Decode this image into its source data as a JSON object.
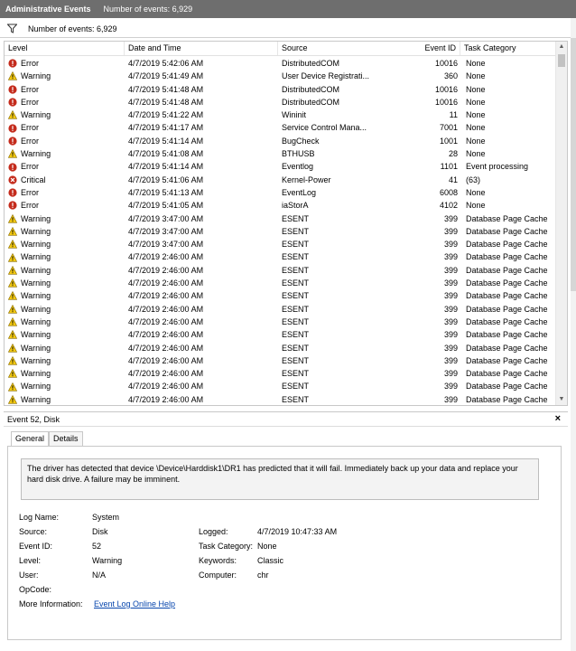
{
  "window": {
    "title": "Administrative Events",
    "count_label": "Number of events: 6,929"
  },
  "filter": {
    "label": "Number of events: 6,929"
  },
  "columns": {
    "level": "Level",
    "date": "Date and Time",
    "source": "Source",
    "event_id": "Event ID",
    "task": "Task Category"
  },
  "events": [
    {
      "level": "Error",
      "icon": "error",
      "date": "4/7/2019 5:42:06 AM",
      "source": "DistributedCOM",
      "id": "10016",
      "task": "None"
    },
    {
      "level": "Warning",
      "icon": "warning",
      "date": "4/7/2019 5:41:49 AM",
      "source": "User Device Registrati...",
      "id": "360",
      "task": "None"
    },
    {
      "level": "Error",
      "icon": "error",
      "date": "4/7/2019 5:41:48 AM",
      "source": "DistributedCOM",
      "id": "10016",
      "task": "None"
    },
    {
      "level": "Error",
      "icon": "error",
      "date": "4/7/2019 5:41:48 AM",
      "source": "DistributedCOM",
      "id": "10016",
      "task": "None"
    },
    {
      "level": "Warning",
      "icon": "warning",
      "date": "4/7/2019 5:41:22 AM",
      "source": "Wininit",
      "id": "11",
      "task": "None"
    },
    {
      "level": "Error",
      "icon": "error",
      "date": "4/7/2019 5:41:17 AM",
      "source": "Service Control Mana...",
      "id": "7001",
      "task": "None"
    },
    {
      "level": "Error",
      "icon": "error",
      "date": "4/7/2019 5:41:14 AM",
      "source": "BugCheck",
      "id": "1001",
      "task": "None"
    },
    {
      "level": "Warning",
      "icon": "warning",
      "date": "4/7/2019 5:41:08 AM",
      "source": "BTHUSB",
      "id": "28",
      "task": "None"
    },
    {
      "level": "Error",
      "icon": "error",
      "date": "4/7/2019 5:41:14 AM",
      "source": "Eventlog",
      "id": "1101",
      "task": "Event processing"
    },
    {
      "level": "Critical",
      "icon": "critical",
      "date": "4/7/2019 5:41:06 AM",
      "source": "Kernel-Power",
      "id": "41",
      "task": "(63)"
    },
    {
      "level": "Error",
      "icon": "error",
      "date": "4/7/2019 5:41:13 AM",
      "source": "EventLog",
      "id": "6008",
      "task": "None"
    },
    {
      "level": "Error",
      "icon": "error",
      "date": "4/7/2019 5:41:05 AM",
      "source": "iaStorA",
      "id": "4102",
      "task": "None"
    },
    {
      "level": "Warning",
      "icon": "warning",
      "date": "4/7/2019 3:47:00 AM",
      "source": "ESENT",
      "id": "399",
      "task": "Database Page Cache"
    },
    {
      "level": "Warning",
      "icon": "warning",
      "date": "4/7/2019 3:47:00 AM",
      "source": "ESENT",
      "id": "399",
      "task": "Database Page Cache"
    },
    {
      "level": "Warning",
      "icon": "warning",
      "date": "4/7/2019 3:47:00 AM",
      "source": "ESENT",
      "id": "399",
      "task": "Database Page Cache"
    },
    {
      "level": "Warning",
      "icon": "warning",
      "date": "4/7/2019 2:46:00 AM",
      "source": "ESENT",
      "id": "399",
      "task": "Database Page Cache"
    },
    {
      "level": "Warning",
      "icon": "warning",
      "date": "4/7/2019 2:46:00 AM",
      "source": "ESENT",
      "id": "399",
      "task": "Database Page Cache"
    },
    {
      "level": "Warning",
      "icon": "warning",
      "date": "4/7/2019 2:46:00 AM",
      "source": "ESENT",
      "id": "399",
      "task": "Database Page Cache"
    },
    {
      "level": "Warning",
      "icon": "warning",
      "date": "4/7/2019 2:46:00 AM",
      "source": "ESENT",
      "id": "399",
      "task": "Database Page Cache"
    },
    {
      "level": "Warning",
      "icon": "warning",
      "date": "4/7/2019 2:46:00 AM",
      "source": "ESENT",
      "id": "399",
      "task": "Database Page Cache"
    },
    {
      "level": "Warning",
      "icon": "warning",
      "date": "4/7/2019 2:46:00 AM",
      "source": "ESENT",
      "id": "399",
      "task": "Database Page Cache"
    },
    {
      "level": "Warning",
      "icon": "warning",
      "date": "4/7/2019 2:46:00 AM",
      "source": "ESENT",
      "id": "399",
      "task": "Database Page Cache"
    },
    {
      "level": "Warning",
      "icon": "warning",
      "date": "4/7/2019 2:46:00 AM",
      "source": "ESENT",
      "id": "399",
      "task": "Database Page Cache"
    },
    {
      "level": "Warning",
      "icon": "warning",
      "date": "4/7/2019 2:46:00 AM",
      "source": "ESENT",
      "id": "399",
      "task": "Database Page Cache"
    },
    {
      "level": "Warning",
      "icon": "warning",
      "date": "4/7/2019 2:46:00 AM",
      "source": "ESENT",
      "id": "399",
      "task": "Database Page Cache"
    },
    {
      "level": "Warning",
      "icon": "warning",
      "date": "4/7/2019 2:46:00 AM",
      "source": "ESENT",
      "id": "399",
      "task": "Database Page Cache"
    },
    {
      "level": "Warning",
      "icon": "warning",
      "date": "4/7/2019 2:46:00 AM",
      "source": "ESENT",
      "id": "399",
      "task": "Database Page Cache"
    },
    {
      "level": "Warning",
      "icon": "warning",
      "date": "4/7/2019 2:46:00 AM",
      "source": "ESENT",
      "id": "399",
      "task": "Database Page Cache"
    }
  ],
  "detail": {
    "title": "Event 52, Disk",
    "close": "×",
    "tabs": [
      "General",
      "Details"
    ],
    "description": "The driver has detected that device \\Device\\Harddisk1\\DR1 has predicted that it will fail. Immediately back up your data and replace your hard disk drive. A failure may be imminent.",
    "log_name_label": "Log Name:",
    "log_name": "System",
    "source_label": "Source:",
    "source": "Disk",
    "logged_label": "Logged:",
    "logged": "4/7/2019 10:47:33 AM",
    "event_id_label": "Event ID:",
    "event_id": "52",
    "task_label": "Task Category:",
    "task": "None",
    "level_label": "Level:",
    "level": "Warning",
    "keywords_label": "Keywords:",
    "keywords": "Classic",
    "user_label": "User:",
    "user": "N/A",
    "computer_label": "Computer:",
    "computer": "chr",
    "opcode_label": "OpCode:",
    "opcode": "",
    "more_info_label": "More Information:",
    "more_info_link": "Event Log Online Help"
  },
  "colors": {
    "error": "#c42b1c",
    "critical": "#c42b1c",
    "warning": "#f2c811",
    "titlebar": "#6e6e6e",
    "link": "#0645ad"
  },
  "icons": {
    "error": "error-icon",
    "warning": "warning-icon",
    "critical": "critical-icon",
    "filter": "filter-icon"
  }
}
